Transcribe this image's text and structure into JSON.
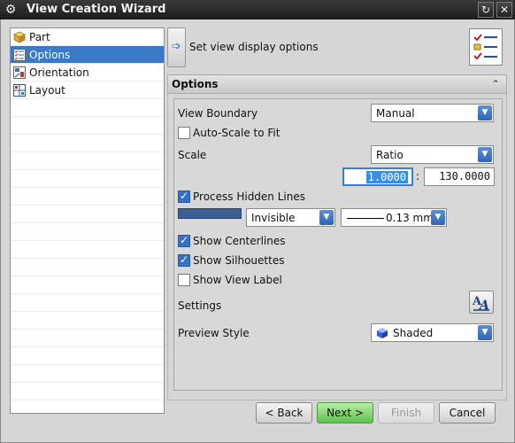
{
  "window": {
    "title": "View Creation Wizard"
  },
  "steps": [
    {
      "label": "Part",
      "icon": "part-cube-icon",
      "active": false
    },
    {
      "label": "Options",
      "icon": "options-checklist-icon",
      "active": true
    },
    {
      "label": "Orientation",
      "icon": "orientation-icon",
      "active": false
    },
    {
      "label": "Layout",
      "icon": "layout-grid-icon",
      "active": false
    }
  ],
  "header": {
    "step_title": "Set view display options"
  },
  "options": {
    "group_title": "Options",
    "view_boundary_label": "View Boundary",
    "view_boundary_value": "Manual",
    "auto_scale_label": "Auto-Scale to Fit",
    "auto_scale_checked": false,
    "scale_label": "Scale",
    "scale_value": "Ratio",
    "scale_numerator": "1.0000",
    "scale_separator": ":",
    "scale_denominator": "130.0000",
    "process_hidden_label": "Process Hidden Lines",
    "process_hidden_checked": true,
    "hidden_line_font": "Invisible",
    "hidden_line_width": "0.13 mm",
    "hidden_line_color": "#3b5f94",
    "show_centerlines_label": "Show Centerlines",
    "show_centerlines_checked": true,
    "show_silhouettes_label": "Show Silhouettes",
    "show_silhouettes_checked": true,
    "show_view_label_label": "Show View Label",
    "show_view_label_checked": false,
    "settings_label": "Settings",
    "preview_style_label": "Preview Style",
    "preview_style_value": "Shaded"
  },
  "buttons": {
    "back": "< Back",
    "next": "Next >",
    "finish": "Finish",
    "cancel": "Cancel"
  }
}
